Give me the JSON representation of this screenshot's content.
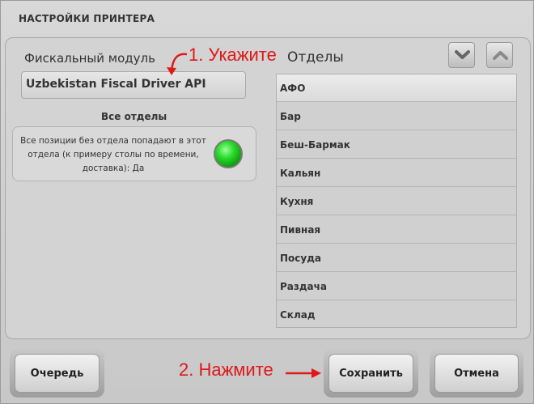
{
  "dialog": {
    "title": "НАСТРОЙКИ ПРИНТЕРА"
  },
  "fiscal": {
    "label": "Фискальный модуль",
    "value": "Uzbekistan Fiscal Driver API"
  },
  "annotations": {
    "step1": "1. Укажите",
    "step2": "2. Нажмите",
    "color": "#e01818"
  },
  "all_departments": {
    "title": "Все отделы",
    "description": "Все позиции без отдела попадают в этот отдела (к примеру столы по времени, доставка): Да",
    "toggle_on": true
  },
  "departments": {
    "label": "Отделы",
    "scroll_down_icon": "chevron-down-icon",
    "scroll_up_icon": "chevron-up-icon",
    "items": [
      "АФО",
      "Бар",
      "Беш-Бармак",
      "Кальян",
      "Кухня",
      "Пивная",
      "Посуда",
      "Раздача",
      "Склад"
    ],
    "selected_index": 0
  },
  "buttons": {
    "queue": "Очередь",
    "save": "Сохранить",
    "cancel": "Отмена"
  }
}
